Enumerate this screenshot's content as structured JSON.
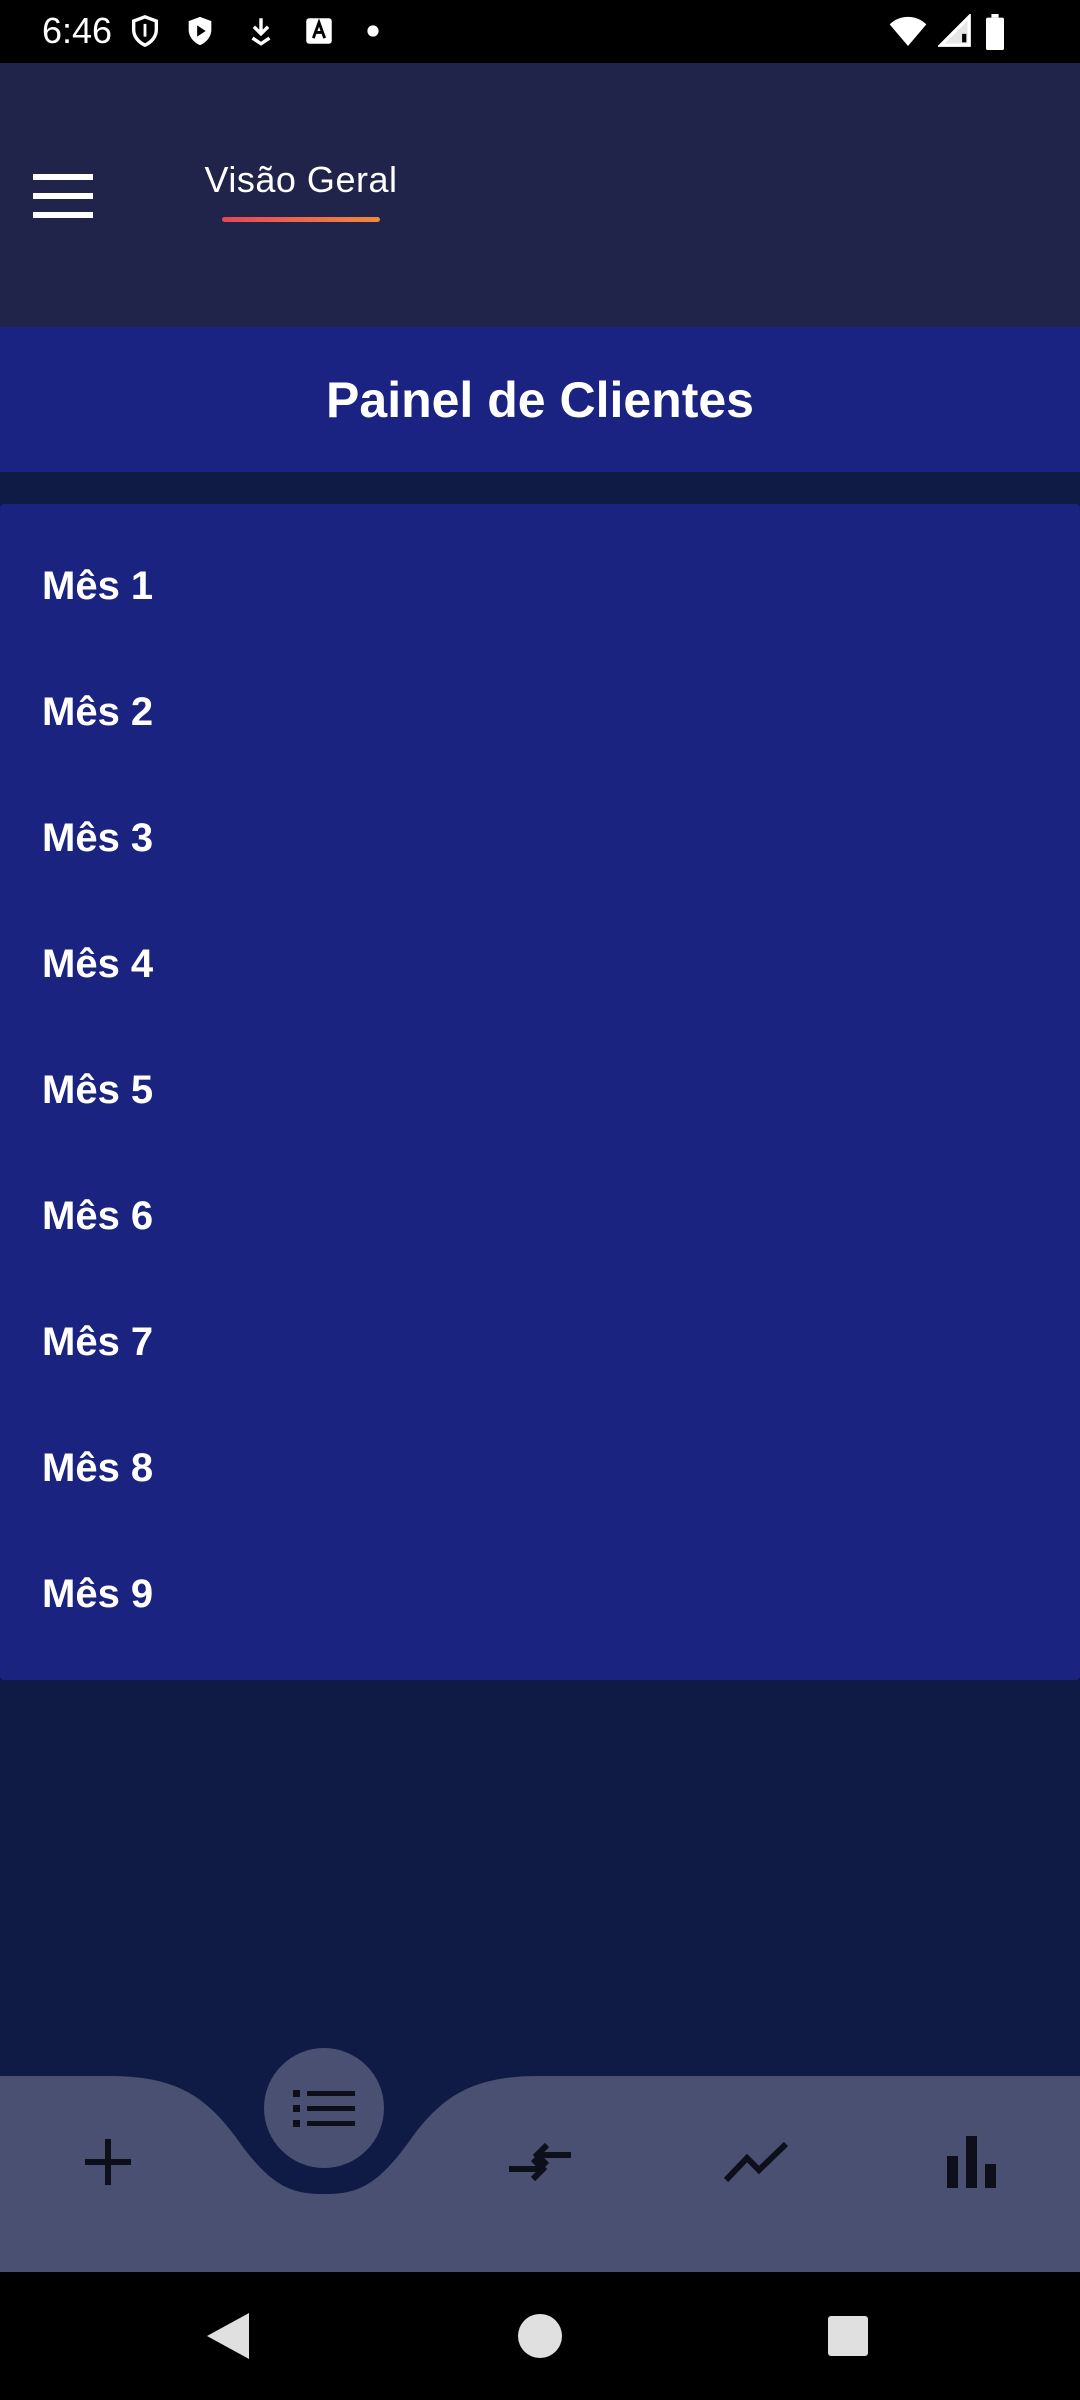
{
  "status_bar": {
    "time": "6:46"
  },
  "app_bar": {
    "menu_icon": "hamburger-menu-icon",
    "tab_label": "Visão Geral"
  },
  "header": {
    "title": "Painel de Clientes"
  },
  "list": {
    "items": [
      {
        "label": "Mês 1"
      },
      {
        "label": "Mês 2"
      },
      {
        "label": "Mês 3"
      },
      {
        "label": "Mês 4"
      },
      {
        "label": "Mês 5"
      },
      {
        "label": "Mês 6"
      },
      {
        "label": "Mês 7"
      },
      {
        "label": "Mês 8"
      },
      {
        "label": "Mês 9"
      }
    ]
  },
  "bottom_nav": {
    "items": [
      {
        "icon": "add-icon"
      },
      {
        "icon": "list-icon",
        "selected": true
      },
      {
        "icon": "compare-arrows-icon"
      },
      {
        "icon": "trending-line-icon"
      },
      {
        "icon": "bar-chart-icon"
      }
    ]
  },
  "colors": {
    "background": "#0f1a45",
    "app_bar": "#21244a",
    "header_band": "#1b2382",
    "list_card": "#1b2380",
    "bottom_nav": "#4a5072",
    "tab_indicator_start": "#e5465a",
    "tab_indicator_end": "#f08a3c"
  }
}
